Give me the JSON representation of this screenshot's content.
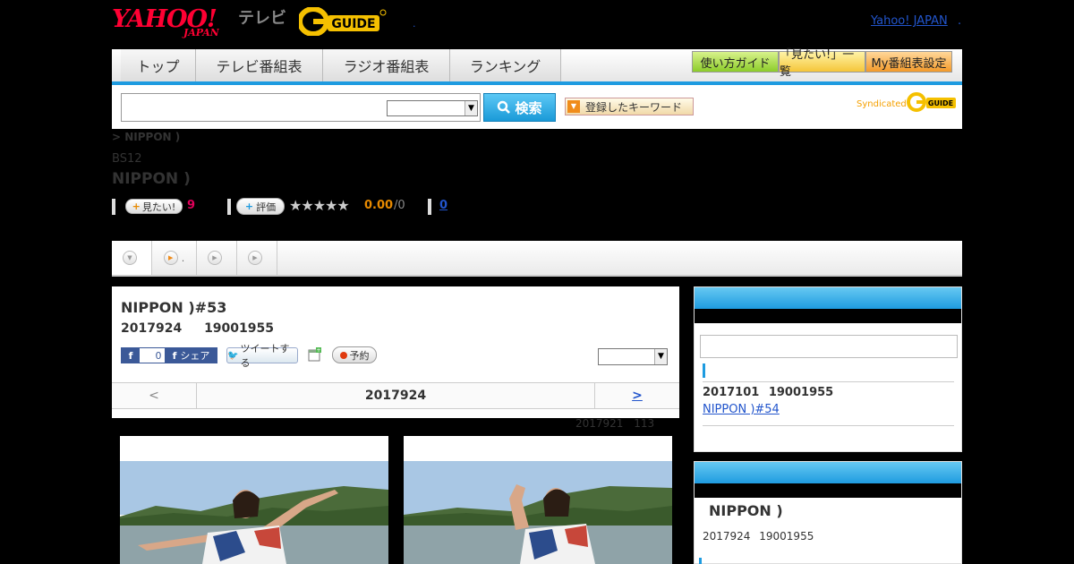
{
  "header": {
    "yahoo_logo": "YAHOO!",
    "yahoo_sub": "JAPAN",
    "tv_label": "テレビ",
    "gguide_logo": "G-GUIDE",
    "dot_link": ".",
    "yahoo_japan_link": "Yahoo! JAPAN",
    "yahoo_japan_link_tail": "."
  },
  "nav": {
    "tabs": [
      {
        "label": "トップ"
      },
      {
        "label": "テレビ番組表"
      },
      {
        "label": "ラジオ番組表"
      },
      {
        "label": "ランキング"
      }
    ],
    "buttons": [
      {
        "label": "使い方ガイド"
      },
      {
        "label": "「見たい!」一覧"
      },
      {
        "label": "My番組表設定"
      }
    ]
  },
  "search": {
    "query": "",
    "select_value": "",
    "button_label": "検索",
    "keyword_button_label": "登録したキーワード",
    "syndicated_label": "Syndicated",
    "syndicated_logo": "G-GUIDE"
  },
  "program": {
    "breadcrumb": "> NIPPON )",
    "channel": "BS12",
    "title": "NIPPON )",
    "mitai_label": "見たい!",
    "mitai_count": "9",
    "hyoka_label": "評価",
    "stars": "★★★★★",
    "score": "0.00",
    "score_count": "/0",
    "review_link": "0"
  },
  "tabs": [
    {
      "label": ""
    },
    {
      "label": "."
    },
    {
      "label": ""
    },
    {
      "label": ""
    }
  ],
  "episode": {
    "title": "NIPPON )#53",
    "date": "2017924 19001955",
    "fb_count": "0",
    "share_label": "シェア",
    "tweet_label": "ツイートする",
    "reserve_label": "予約",
    "select_value": "",
    "pager_prev": "<",
    "pager_date": "2017924",
    "pager_next": ">",
    "update_note": "2017921 113"
  },
  "sidebar": {
    "next_date": "2017101 19001955",
    "next_link": "NIPPON )#54",
    "current_title": "NIPPON )",
    "current_date": "2017924 19001955"
  },
  "colors": {
    "accent_blue": "#1e9be0",
    "yahoo_red": "#ff0033",
    "pink_count": "#e0005a",
    "score_orange": "#e88a00",
    "link_blue": "#2255cc"
  }
}
